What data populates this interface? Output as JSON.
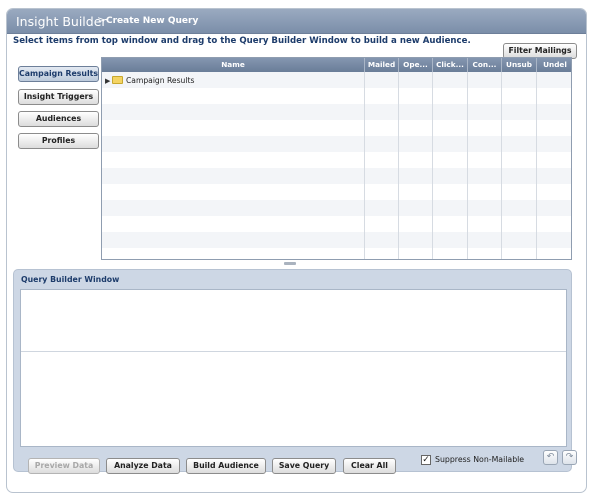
{
  "header": {
    "app_title": "Insight Builder",
    "separator": ">",
    "breadcrumb": "Create New Query"
  },
  "instruction": "Select items from top window and drag to the Query Builder Window to build a new Audience.",
  "filter_button": "Filter Mailings",
  "sidebar": {
    "items": [
      {
        "label": "Campaign Results",
        "selected": true
      },
      {
        "label": "Insight Triggers",
        "selected": false
      },
      {
        "label": "Audiences",
        "selected": false
      },
      {
        "label": "Profiles",
        "selected": false
      }
    ]
  },
  "grid": {
    "columns": [
      "Name",
      "Mailed",
      "Ope...",
      "Click...",
      "Con...",
      "Unsub",
      "Undel"
    ],
    "rows": [
      {
        "name": "Campaign Results",
        "expand_icon": "triangle-right-icon",
        "type_icon": "folder-icon"
      }
    ]
  },
  "query_builder": {
    "title": "Query Builder Window"
  },
  "actions": {
    "preview": "Preview Data",
    "analyze": "Analyze Data",
    "build": "Build Audience",
    "save": "Save Query",
    "clear": "Clear All"
  },
  "suppress": {
    "label": "Suppress Non-Mailable",
    "checked": true,
    "mark": "✓"
  },
  "icons": {
    "undo": "↶",
    "redo": "↷"
  },
  "colors": {
    "title_bar": "#8194ae",
    "accent_text": "#1d3c6b",
    "folder": "#f4d463"
  }
}
